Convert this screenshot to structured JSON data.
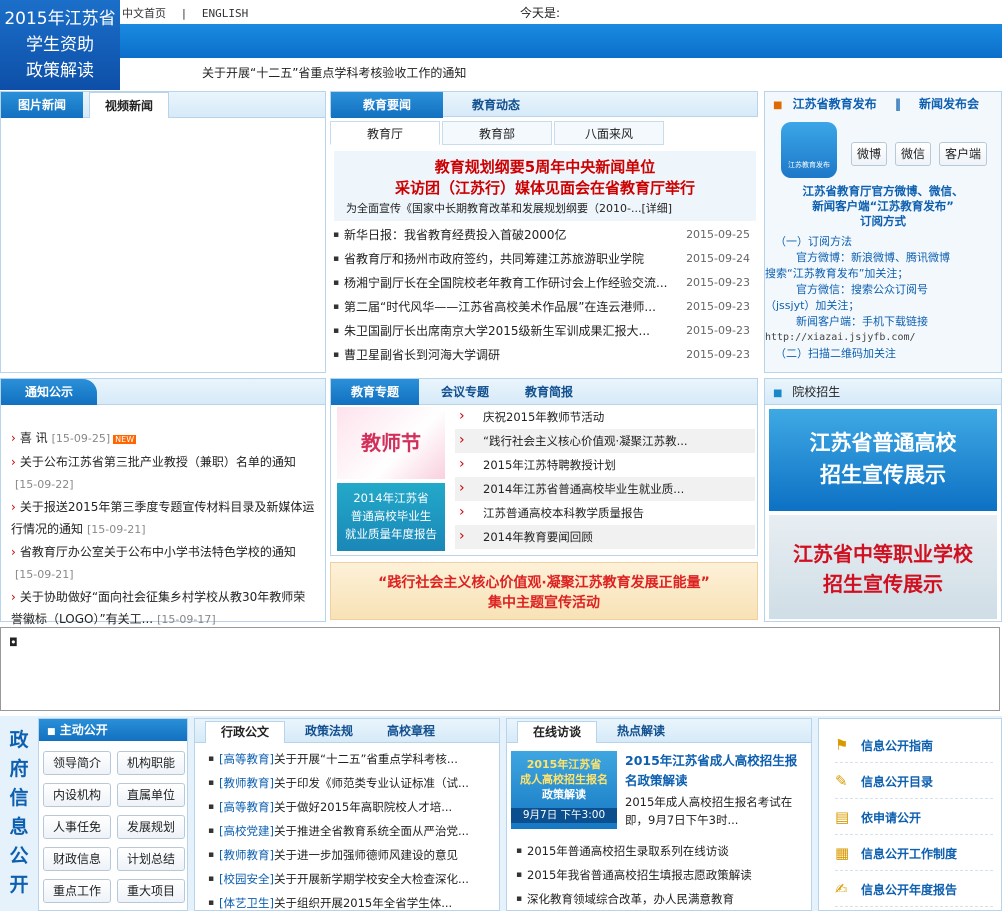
{
  "header": {
    "links": [
      "中文首页",
      "|",
      "ENGLISH"
    ],
    "today": "今天是:",
    "promo": [
      "2015年江苏省",
      "学生资助",
      "政策解读"
    ],
    "ticker": "关于开展“十二五”省重点学科考核验收工作的通知"
  },
  "pic_news": {
    "tabs": [
      "图片新闻",
      "视频新闻"
    ]
  },
  "edu_news": {
    "tabs": [
      "教育要闻",
      "教育动态"
    ],
    "subtabs": [
      "教育厅",
      "教育部",
      "八面来风"
    ],
    "headline": [
      "教育规划纲要5周年中央新闻单位",
      "采访团（江苏行）媒体见面会在省教育厅举行"
    ],
    "summary": "为全面宣传《国家中长期教育改革和发展规划纲要（2010-...",
    "summary_link": "[详细]",
    "items": [
      {
        "t": "新华日报：我省教育经费投入首破2000亿",
        "d": "2015-09-25"
      },
      {
        "t": "省教育厅和扬州市政府签约，共同筹建江苏旅游职业学院",
        "d": "2015-09-24"
      },
      {
        "t": "杨湘宁副厅长在全国院校老年教育工作研讨会上作经验交流...",
        "d": "2015-09-23"
      },
      {
        "t": "第二届“时代风华——江苏省高校美术作品展”在连云港师...",
        "d": "2015-09-23"
      },
      {
        "t": "朱卫国副厅长出席南京大学2015级新生军训成果汇报大...",
        "d": "2015-09-23"
      },
      {
        "t": "曹卫星副省长到河海大学调研",
        "d": "2015-09-23"
      }
    ]
  },
  "weibo": {
    "tabs": [
      "江苏省教育发布",
      "‖",
      "新闻发布会"
    ],
    "logo_text": "江苏教育发布",
    "buttons": [
      "微博",
      "微信",
      "客户端"
    ],
    "title": [
      "江苏省教育厅官方微博、微信、",
      "新闻客户端“江苏教育发布”",
      "订阅方式"
    ],
    "lines": [
      "（一）订阅方法",
      "　官方微博：新浪微博、腾讯微博",
      "搜索“江苏教育发布”加关注；",
      "　官方微信：搜索公众订阅号",
      "（jssjyt）加关注；",
      "　新闻客户端：手机下载链接",
      "http://xiazai.jsjyfb.com/",
      "（二）扫描二维码加关注"
    ]
  },
  "notice": {
    "title": "通知公示",
    "items": [
      {
        "t": "喜 讯",
        "d": "[15-09-25]",
        "new": "NEW"
      },
      {
        "t": "关于公布江苏省第三批产业教授（兼职）名单的通知",
        "d": "[15-09-22]"
      },
      {
        "t": "关于报送2015年第三季度专题宣传材料目录及新媒体运行情况的通知",
        "d": "[15-09-21]"
      },
      {
        "t": "省教育厅办公室关于公布中小学书法特色学校的通知",
        "d": "[15-09-21]"
      },
      {
        "t": "关于协助做好“面向社会征集乡村学校从教30年教师荣誉徽标（LOGO）”有关工...",
        "d": "[15-09-17]"
      }
    ]
  },
  "topics": {
    "tabs": [
      "教育专题",
      "会议专题",
      "教育简报"
    ],
    "img1": "教师节",
    "img2": [
      "2014年江苏省",
      "普通高校毕业生",
      "就业质量年度报告"
    ],
    "items": [
      "庆祝2015年教师节活动",
      "“践行社会主义核心价值观·凝聚江苏教...",
      "2015年江苏特聘教授计划",
      "2014年江苏省普通高校毕业生就业质...",
      "江苏普通高校本科教学质量报告",
      "2014年教育要闻回顾"
    ],
    "banner": [
      "“践行社会主义核心价值观·凝聚江苏教育发展正能量”",
      "集中主题宣传活动"
    ]
  },
  "admission": {
    "title": "院校招生",
    "banner1": [
      "江苏省普通高校",
      "招生宣传展示"
    ],
    "banner2": [
      "江苏省中等职业学校",
      "招生宣传展示"
    ]
  },
  "info": {
    "side": "政府信息公开",
    "main_title": "主动公开",
    "buttons": [
      "领导简介",
      "机构职能",
      "内设机构",
      "直属单位",
      "人事任免",
      "发展规划",
      "财政信息",
      "计划总结",
      "重点工作",
      "重大项目"
    ],
    "doc_tabs": [
      "行政公文",
      "政策法规",
      "高校章程"
    ],
    "docs": [
      {
        "c": "[高等教育]",
        "t": "关于开展“十二五”省重点学科考核..."
      },
      {
        "c": "[教师教育]",
        "t": "关于印发《师范类专业认证标准（试..."
      },
      {
        "c": "[高等教育]",
        "t": "关于做好2015年高职院校人才培..."
      },
      {
        "c": "[高校党建]",
        "t": "关于推进全省教育系统全面从严治党..."
      },
      {
        "c": "[教师教育]",
        "t": "关于进一步加强师德师风建设的意见"
      },
      {
        "c": "[校园安全]",
        "t": "关于开展新学期学校安全大检查深化..."
      },
      {
        "c": "[体艺卫生]",
        "t": "关于组织开展2015年全省学生体..."
      }
    ],
    "online_tabs": [
      "在线访谈",
      "热点解读"
    ],
    "online_img": [
      "2015年江苏省",
      "成人高校招生报名",
      "政策解读",
      "9月7日 下午3:00"
    ],
    "online_title": "2015年江苏省成人高校招生报名政策解读",
    "online_desc": "2015年成人高校招生报名考试在即，9月7日下午3时...",
    "online_items": [
      "2015年普通高校招生录取系列在线访谈",
      "2015年我省普通高校招生填报志愿政策解读",
      "深化教育领域综合改革，办人民满意教育"
    ],
    "guides": [
      {
        "icon": "flag-icon",
        "t": "信息公开指南"
      },
      {
        "icon": "edit-icon",
        "t": "信息公开目录"
      },
      {
        "icon": "book-icon",
        "t": "依申请公开"
      },
      {
        "icon": "grid-icon",
        "t": "信息公开工作制度"
      },
      {
        "icon": "report-icon",
        "t": "信息公开年度报告"
      }
    ]
  },
  "colors": {
    "blue": "#1270c0",
    "red": "#cc0000",
    "border": "#b9d3ea"
  }
}
